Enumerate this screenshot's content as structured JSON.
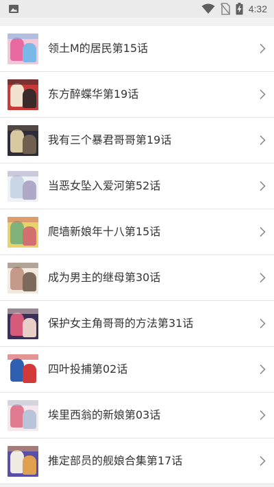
{
  "status_bar": {
    "time": "4:32",
    "icons": [
      "image-icon",
      "wifi-icon",
      "no-sim-icon",
      "battery-charging-icon"
    ]
  },
  "items": [
    {
      "title": "领土M的居民第15话",
      "thumb_colors": [
        "#f4c6d6",
        "#e86aa0",
        "#7ab8e8"
      ]
    },
    {
      "title": "东方醉蝶华第19话",
      "thumb_colors": [
        "#c83a3a",
        "#f1e3d0",
        "#3b2a2a"
      ]
    },
    {
      "title": "我有三个暴君哥哥第19话",
      "thumb_colors": [
        "#2c2c3a",
        "#d9c9a0",
        "#6f5f4f"
      ]
    },
    {
      "title": "当恶女坠入爱河第52话",
      "thumb_colors": [
        "#eef2f6",
        "#c9d6e6",
        "#b0a8c8"
      ]
    },
    {
      "title": "爬墙新娘年十八第15话",
      "thumb_colors": [
        "#e8d26a",
        "#7fb37a",
        "#d46f6f"
      ]
    },
    {
      "title": "成为男主的继母第30话",
      "thumb_colors": [
        "#f3eadf",
        "#c69a8a",
        "#7c6b5d"
      ]
    },
    {
      "title": "保护女主角哥哥的方法第31话",
      "thumb_colors": [
        "#3a2f5a",
        "#d65a7a",
        "#e8d0c8"
      ]
    },
    {
      "title": "四叶投捕第02话",
      "thumb_colors": [
        "#ffffff",
        "#2f5fb0",
        "#d23a3a"
      ]
    },
    {
      "title": "埃里西翁的新娘第03话",
      "thumb_colors": [
        "#f7e6ea",
        "#e27a8f",
        "#b8c4d8"
      ]
    },
    {
      "title": "推定部员的舰娘合集第17话",
      "thumb_colors": [
        "#5a4fa8",
        "#f0ece4",
        "#e0a050"
      ]
    }
  ]
}
